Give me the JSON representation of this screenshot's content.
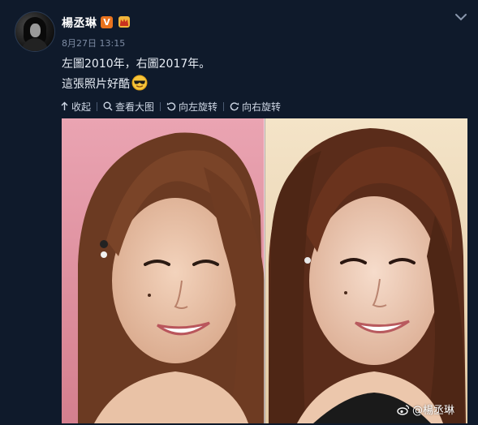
{
  "post": {
    "author_name": "楊丞琳",
    "verified_badge": "V",
    "timestamp": "8月27日 13:15",
    "text_line1": "左圖2010年，右圖2017年。",
    "text_line2": "這張照片好酷",
    "emoji": "sunglasses-smile-emoji"
  },
  "toolbar": {
    "collapse_label": "收起",
    "view_large_label": "查看大图",
    "rotate_left_label": "向左旋转",
    "rotate_right_label": "向右旋转"
  },
  "image": {
    "watermark": "@楊丞琳"
  },
  "colors": {
    "background": "#0f1a2b",
    "text": "#e8eef6",
    "muted": "#7d8ba3",
    "badge": "#e8731e",
    "left_photo_bg": "#e8a0a8",
    "right_photo_bg": "#f0dcc0"
  }
}
